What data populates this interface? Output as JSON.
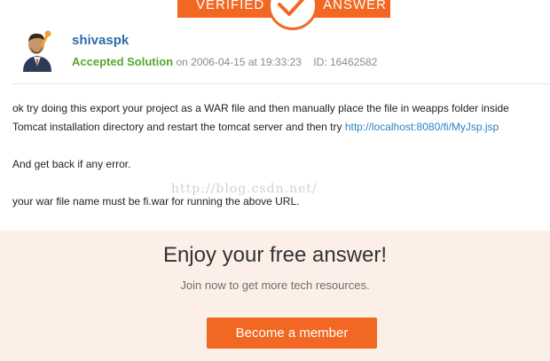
{
  "banner": {
    "left_text": "VERIFIED",
    "right_text": "ANSWER",
    "icon": "checkmark-icon",
    "accent_color": "#f26722"
  },
  "author": {
    "name": "shivaspk",
    "avatar_icon": "user-avatar-icon",
    "status": "Accepted Solution",
    "date_prefix": "on 2006-04-15 at 19:33:23",
    "id_label": "ID: 16462582"
  },
  "answer": {
    "line1_text": "ok try doing this export your project as a WAR file and then manually place the file in weapps folder inside Tomcat installation directory and restart the tomcat server and then try ",
    "link_text": "http://localhost:8080/fi/MyJsp.jsp",
    "line2": "And get back if any error.",
    "line3": "your war file name must be fi.war for running the above URL."
  },
  "watermark": "http://blog.csdn.net/",
  "cta": {
    "title": "Enjoy your free answer!",
    "subtitle": "Join now to get more tech resources.",
    "button_label": "Become a member"
  }
}
